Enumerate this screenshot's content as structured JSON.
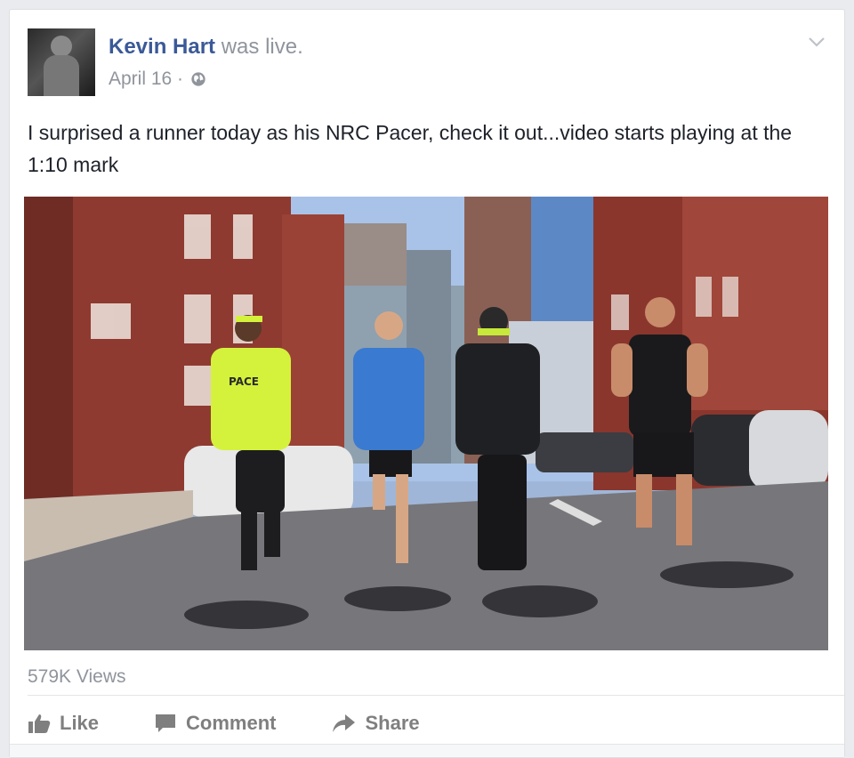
{
  "post": {
    "author": "Kevin Hart",
    "action": "was live.",
    "date": "April 16 ·",
    "text": "I surprised a runner today as his NRC Pacer, check it out...video starts playing at the 1:10 mark",
    "views": "579K Views",
    "privacy_icon": "globe-icon",
    "menu_icon": "chevron-down-icon"
  },
  "video": {
    "shirt_text": "PACE"
  },
  "actions": {
    "like": "Like",
    "comment": "Comment",
    "share": "Share"
  },
  "colors": {
    "link": "#3b5998",
    "meta": "#90949c",
    "text": "#1d2129"
  }
}
